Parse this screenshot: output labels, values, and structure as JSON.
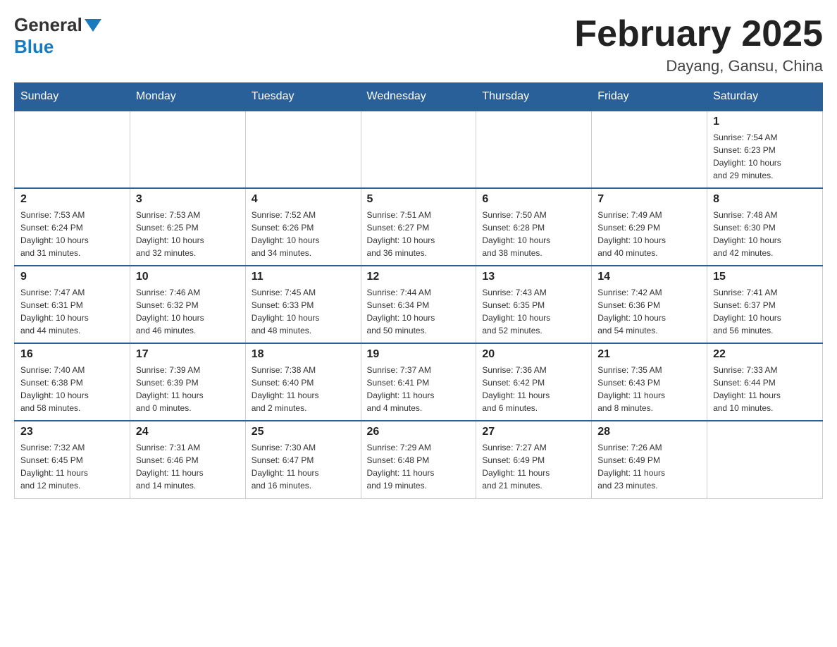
{
  "header": {
    "logo_general": "General",
    "logo_blue": "Blue",
    "month_title": "February 2025",
    "location": "Dayang, Gansu, China"
  },
  "days_of_week": [
    "Sunday",
    "Monday",
    "Tuesday",
    "Wednesday",
    "Thursday",
    "Friday",
    "Saturday"
  ],
  "weeks": [
    {
      "days": [
        {
          "number": "",
          "info": ""
        },
        {
          "number": "",
          "info": ""
        },
        {
          "number": "",
          "info": ""
        },
        {
          "number": "",
          "info": ""
        },
        {
          "number": "",
          "info": ""
        },
        {
          "number": "",
          "info": ""
        },
        {
          "number": "1",
          "info": "Sunrise: 7:54 AM\nSunset: 6:23 PM\nDaylight: 10 hours\nand 29 minutes."
        }
      ]
    },
    {
      "days": [
        {
          "number": "2",
          "info": "Sunrise: 7:53 AM\nSunset: 6:24 PM\nDaylight: 10 hours\nand 31 minutes."
        },
        {
          "number": "3",
          "info": "Sunrise: 7:53 AM\nSunset: 6:25 PM\nDaylight: 10 hours\nand 32 minutes."
        },
        {
          "number": "4",
          "info": "Sunrise: 7:52 AM\nSunset: 6:26 PM\nDaylight: 10 hours\nand 34 minutes."
        },
        {
          "number": "5",
          "info": "Sunrise: 7:51 AM\nSunset: 6:27 PM\nDaylight: 10 hours\nand 36 minutes."
        },
        {
          "number": "6",
          "info": "Sunrise: 7:50 AM\nSunset: 6:28 PM\nDaylight: 10 hours\nand 38 minutes."
        },
        {
          "number": "7",
          "info": "Sunrise: 7:49 AM\nSunset: 6:29 PM\nDaylight: 10 hours\nand 40 minutes."
        },
        {
          "number": "8",
          "info": "Sunrise: 7:48 AM\nSunset: 6:30 PM\nDaylight: 10 hours\nand 42 minutes."
        }
      ]
    },
    {
      "days": [
        {
          "number": "9",
          "info": "Sunrise: 7:47 AM\nSunset: 6:31 PM\nDaylight: 10 hours\nand 44 minutes."
        },
        {
          "number": "10",
          "info": "Sunrise: 7:46 AM\nSunset: 6:32 PM\nDaylight: 10 hours\nand 46 minutes."
        },
        {
          "number": "11",
          "info": "Sunrise: 7:45 AM\nSunset: 6:33 PM\nDaylight: 10 hours\nand 48 minutes."
        },
        {
          "number": "12",
          "info": "Sunrise: 7:44 AM\nSunset: 6:34 PM\nDaylight: 10 hours\nand 50 minutes."
        },
        {
          "number": "13",
          "info": "Sunrise: 7:43 AM\nSunset: 6:35 PM\nDaylight: 10 hours\nand 52 minutes."
        },
        {
          "number": "14",
          "info": "Sunrise: 7:42 AM\nSunset: 6:36 PM\nDaylight: 10 hours\nand 54 minutes."
        },
        {
          "number": "15",
          "info": "Sunrise: 7:41 AM\nSunset: 6:37 PM\nDaylight: 10 hours\nand 56 minutes."
        }
      ]
    },
    {
      "days": [
        {
          "number": "16",
          "info": "Sunrise: 7:40 AM\nSunset: 6:38 PM\nDaylight: 10 hours\nand 58 minutes."
        },
        {
          "number": "17",
          "info": "Sunrise: 7:39 AM\nSunset: 6:39 PM\nDaylight: 11 hours\nand 0 minutes."
        },
        {
          "number": "18",
          "info": "Sunrise: 7:38 AM\nSunset: 6:40 PM\nDaylight: 11 hours\nand 2 minutes."
        },
        {
          "number": "19",
          "info": "Sunrise: 7:37 AM\nSunset: 6:41 PM\nDaylight: 11 hours\nand 4 minutes."
        },
        {
          "number": "20",
          "info": "Sunrise: 7:36 AM\nSunset: 6:42 PM\nDaylight: 11 hours\nand 6 minutes."
        },
        {
          "number": "21",
          "info": "Sunrise: 7:35 AM\nSunset: 6:43 PM\nDaylight: 11 hours\nand 8 minutes."
        },
        {
          "number": "22",
          "info": "Sunrise: 7:33 AM\nSunset: 6:44 PM\nDaylight: 11 hours\nand 10 minutes."
        }
      ]
    },
    {
      "days": [
        {
          "number": "23",
          "info": "Sunrise: 7:32 AM\nSunset: 6:45 PM\nDaylight: 11 hours\nand 12 minutes."
        },
        {
          "number": "24",
          "info": "Sunrise: 7:31 AM\nSunset: 6:46 PM\nDaylight: 11 hours\nand 14 minutes."
        },
        {
          "number": "25",
          "info": "Sunrise: 7:30 AM\nSunset: 6:47 PM\nDaylight: 11 hours\nand 16 minutes."
        },
        {
          "number": "26",
          "info": "Sunrise: 7:29 AM\nSunset: 6:48 PM\nDaylight: 11 hours\nand 19 minutes."
        },
        {
          "number": "27",
          "info": "Sunrise: 7:27 AM\nSunset: 6:49 PM\nDaylight: 11 hours\nand 21 minutes."
        },
        {
          "number": "28",
          "info": "Sunrise: 7:26 AM\nSunset: 6:49 PM\nDaylight: 11 hours\nand 23 minutes."
        },
        {
          "number": "",
          "info": ""
        }
      ]
    }
  ]
}
